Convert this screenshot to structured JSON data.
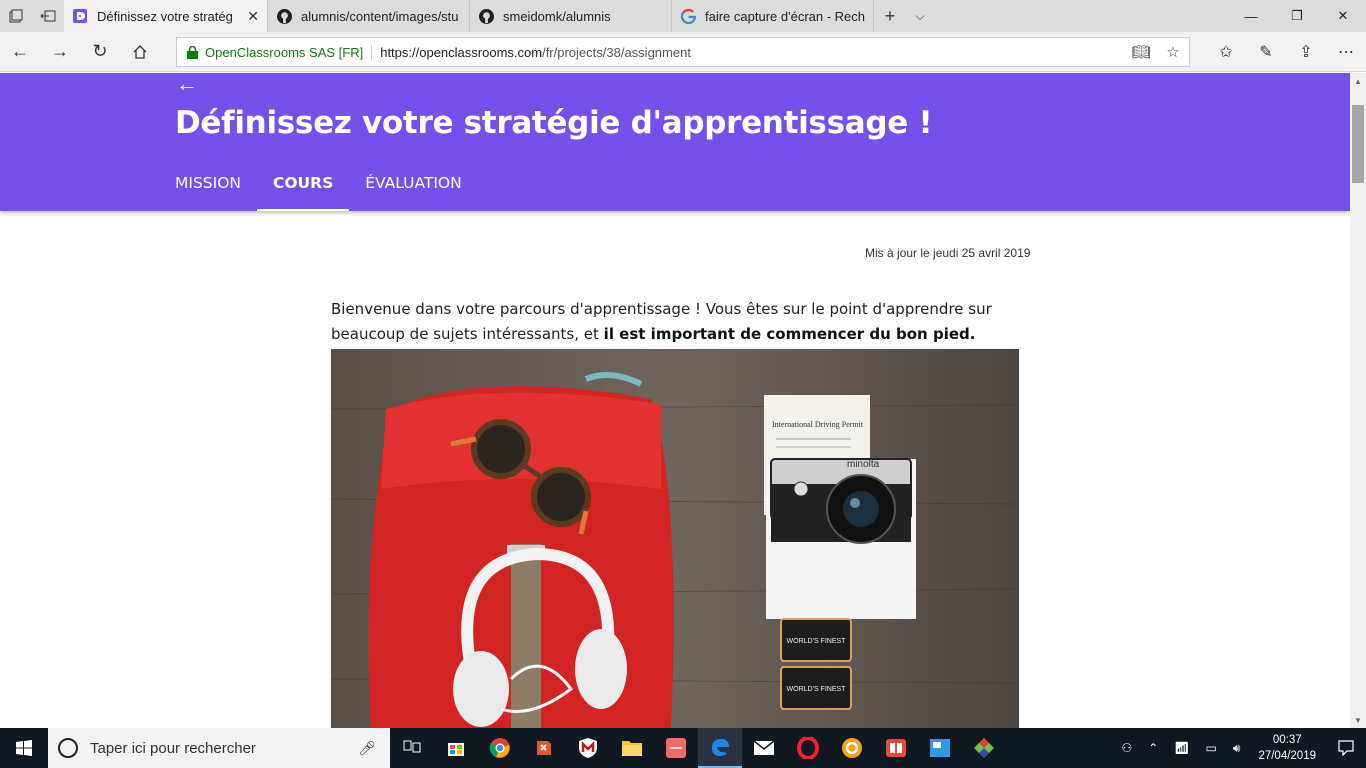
{
  "browser": {
    "tabs": [
      {
        "title": "Définissez votre stratég",
        "active": true,
        "icon": "openclassrooms-icon"
      },
      {
        "title": "alumnis/content/images/stu",
        "active": false,
        "icon": "github-icon"
      },
      {
        "title": "smeidomk/alumnis",
        "active": false,
        "icon": "github-icon"
      },
      {
        "title": "faire capture d'écran - Rech",
        "active": false,
        "icon": "google-icon"
      }
    ],
    "address": {
      "site_identity": "OpenClassrooms SAS [FR]",
      "url_host": "https://openclassrooms.com",
      "url_path": "/fr/projects/38/assignment"
    }
  },
  "page": {
    "title": "Définissez votre stratégie d'apprentissage !",
    "tabs": [
      "MISSION",
      "COURS",
      "ÉVALUATION"
    ],
    "active_tab": "COURS",
    "updated": "Mis à jour le jeudi 25 avril 2019",
    "intro_text": "Bienvenue dans votre parcours d'apprentissage ! Vous êtes sur le point d'apprendre sur beaucoup de sujets intéressants, et ",
    "intro_bold": "il est important de commencer du bon pied.",
    "photo": {
      "permit_text": "International Driving Permit",
      "camera_brand": "minolta",
      "film_label": "WORLD'S FINEST"
    },
    "accent_color": "#7451eb"
  },
  "taskbar": {
    "search_placeholder": "Taper ici pour rechercher",
    "time": "00:37",
    "date": "27/04/2019"
  }
}
